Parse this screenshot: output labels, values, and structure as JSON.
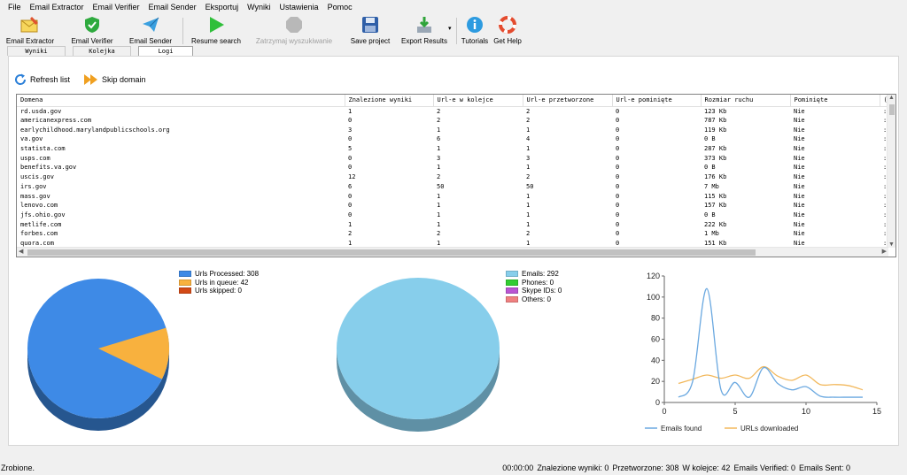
{
  "menu": [
    "File",
    "Email Extractor",
    "Email Verifier",
    "Email Sender",
    "Eksportuj",
    "Wyniki",
    "Ustawienia",
    "Pomoc"
  ],
  "toolbar": {
    "email_extractor": "Email Extractor",
    "email_verifier": "Email Verifier",
    "email_sender": "Email Sender",
    "resume_search": "Resume search",
    "stop_search": "Zatrzymaj wyszukiwanie",
    "save_project": "Save project",
    "export_results": "Export Results",
    "tutorials": "Tutorials",
    "get_help": "Get Help"
  },
  "tabs": [
    "Wyniki",
    "Kolejka",
    "Logi"
  ],
  "subtoolbar": {
    "refresh": "Refresh list",
    "skip": "Skip domain"
  },
  "table": {
    "columns": [
      "Domena",
      "Znalezione wyniki",
      "Url-e w kolejce",
      "Url-e przetworzone",
      "Url-e pominięte",
      "Rozmiar ruchu",
      "Pominięte",
      "("
    ],
    "rows": [
      [
        "rd.usda.gov",
        "1",
        "2",
        "2",
        "0",
        "123 Kb",
        "Nie",
        ":"
      ],
      [
        "americanexpress.com",
        "0",
        "2",
        "2",
        "0",
        "787 Kb",
        "Nie",
        ":"
      ],
      [
        "earlychildhood.marylandpublicschools.org",
        "3",
        "1",
        "1",
        "0",
        "119 Kb",
        "Nie",
        ":"
      ],
      [
        "va.gov",
        "0",
        "6",
        "4",
        "0",
        "0 B",
        "Nie",
        ":"
      ],
      [
        "statista.com",
        "5",
        "1",
        "1",
        "0",
        "287 Kb",
        "Nie",
        ":"
      ],
      [
        "usps.com",
        "0",
        "3",
        "3",
        "0",
        "373 Kb",
        "Nie",
        ":"
      ],
      [
        "benefits.va.gov",
        "0",
        "1",
        "1",
        "0",
        "0 B",
        "Nie",
        ":"
      ],
      [
        "uscis.gov",
        "12",
        "2",
        "2",
        "0",
        "176 Kb",
        "Nie",
        ":"
      ],
      [
        "irs.gov",
        "6",
        "50",
        "50",
        "0",
        "7 Mb",
        "Nie",
        ":"
      ],
      [
        "mass.gov",
        "0",
        "1",
        "1",
        "0",
        "115 Kb",
        "Nie",
        ":"
      ],
      [
        "lenovo.com",
        "0",
        "1",
        "1",
        "0",
        "157 Kb",
        "Nie",
        ":"
      ],
      [
        "jfs.ohio.gov",
        "0",
        "1",
        "1",
        "0",
        "0 B",
        "Nie",
        ":"
      ],
      [
        "metlife.com",
        "1",
        "1",
        "1",
        "0",
        "222 Kb",
        "Nie",
        ":"
      ],
      [
        "forbes.com",
        "2",
        "2",
        "2",
        "0",
        "1 Mb",
        "Nie",
        ":"
      ],
      [
        "quora.com",
        "1",
        "1",
        "1",
        "0",
        "151 Kb",
        "Nie",
        ":"
      ]
    ]
  },
  "colors": {
    "blue": "#3e8ae6",
    "orange": "#f8b13e",
    "red": "#d34a17",
    "sky": "#87ceeb",
    "green": "#32cd32",
    "purple": "#ba55d3",
    "pink": "#f08080",
    "line_blue": "#6aa8e0",
    "line_orange": "#f2b85c"
  },
  "chart_data": [
    {
      "type": "pie",
      "labels": [
        "Urls Processed: 308",
        "Urls in queue: 42",
        "Urls skipped: 0"
      ],
      "values": [
        308,
        42,
        0
      ],
      "colors": [
        "#3e8ae6",
        "#f8b13e",
        "#d34a17"
      ]
    },
    {
      "type": "pie",
      "labels": [
        "Emails: 292",
        "Phones: 0",
        "Skype IDs: 0",
        "Others: 0"
      ],
      "values": [
        292,
        0,
        0,
        0
      ],
      "colors": [
        "#87ceeb",
        "#32cd32",
        "#ba55d3",
        "#f08080"
      ]
    },
    {
      "type": "line",
      "xlim": [
        0,
        15
      ],
      "ylim": [
        0,
        120
      ],
      "xticks": [
        "0",
        "5",
        "10",
        "15"
      ],
      "yticks": [
        "0",
        "20",
        "40",
        "60",
        "80",
        "100",
        "120"
      ],
      "series": [
        {
          "name": "Emails found",
          "color": "#6aa8e0",
          "x": [
            1,
            2,
            3,
            4,
            5,
            6,
            7,
            8,
            9,
            10,
            11,
            12,
            13,
            14
          ],
          "y": [
            5,
            20,
            108,
            12,
            19,
            5,
            33,
            18,
            12,
            15,
            6,
            5,
            5,
            5
          ]
        },
        {
          "name": "URLs downloaded",
          "color": "#f2b85c",
          "x": [
            1,
            2,
            3,
            4,
            5,
            6,
            7,
            8,
            9,
            10,
            11,
            12,
            13,
            14
          ],
          "y": [
            18,
            22,
            26,
            23,
            26,
            23,
            34,
            25,
            21,
            26,
            17,
            17,
            16,
            12
          ]
        }
      ]
    }
  ],
  "status": {
    "left": "Zrobione.",
    "time": "00:00:00",
    "found": "Znalezione wyniki: 0",
    "processed": "Przetworzone: 308",
    "queue": "W kolejce: 42",
    "verified": "Emails Verified: 0",
    "sent": "Emails Sent: 0"
  }
}
